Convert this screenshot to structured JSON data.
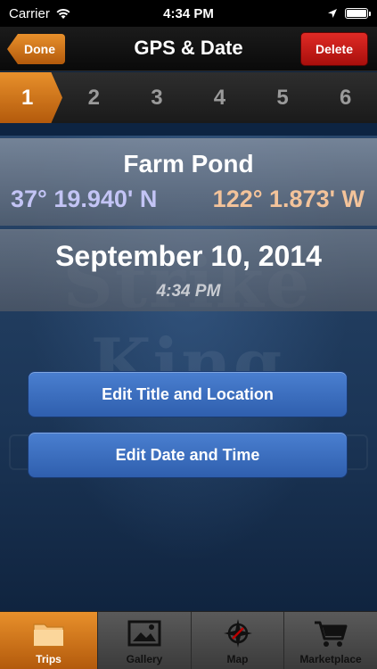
{
  "status_bar": {
    "carrier": "Carrier",
    "time": "4:34 PM"
  },
  "nav": {
    "title": "GPS & Date",
    "done_label": "Done",
    "delete_label": "Delete"
  },
  "steps": [
    "1",
    "2",
    "3",
    "4",
    "5",
    "6"
  ],
  "location": {
    "name": "Farm Pond",
    "latitude": "37° 19.940' N",
    "longitude": "122° 1.873' W"
  },
  "datetime": {
    "date": "September 10, 2014",
    "time": "4:34 PM"
  },
  "actions": {
    "edit_title": "Edit Title and Location",
    "edit_date": "Edit Date and Time"
  },
  "tabs": {
    "trips": "Trips",
    "gallery": "Gallery",
    "map": "Map",
    "marketplace": "Marketplace"
  },
  "colors": {
    "accent_orange": "#d97a1c",
    "delete_red": "#c81c18",
    "button_blue": "#3d6fc0",
    "latitude_color": "#c3c4f5",
    "longitude_color": "#f3c39a"
  }
}
